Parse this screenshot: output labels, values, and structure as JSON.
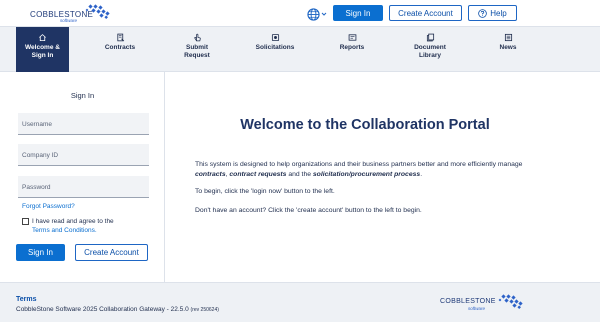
{
  "header": {
    "logo_text": "COBBLESTONE",
    "logo_sub": "software",
    "signin_label": "Sign In",
    "create_account_label": "Create Account",
    "help_label": "Help"
  },
  "nav": {
    "items": [
      {
        "label": "Welcome & Sign In",
        "icon": "home-icon"
      },
      {
        "label": "Contracts",
        "icon": "contract-icon"
      },
      {
        "label": "Submit Request",
        "icon": "hand-pointer-icon"
      },
      {
        "label": "Solicitations",
        "icon": "solicitation-icon"
      },
      {
        "label": "Reports",
        "icon": "reports-icon"
      },
      {
        "label": "Document Library",
        "icon": "document-library-icon"
      },
      {
        "label": "News",
        "icon": "news-icon"
      }
    ]
  },
  "signin": {
    "title": "Sign In",
    "username_placeholder": "Username",
    "company_placeholder": "Company ID",
    "password_placeholder": "Password",
    "forgot_label": "Forgot Password?",
    "agree_text": "I have read and agree to the",
    "terms_link": "Terms and Conditions.",
    "signin_button": "Sign In",
    "create_button": "Create Account"
  },
  "main": {
    "title": "Welcome to the Collaboration Portal",
    "p1_a": "This system is designed to help organizations and their business partners better and more efficiently manage ",
    "p1_b": "contracts",
    "p1_c": ", ",
    "p1_d": "contract requests",
    "p1_e": " and the ",
    "p1_f": "solicitation/procurement process",
    "p1_g": ".",
    "p2": "To begin, click the 'login now' button to the left.",
    "p3": "Don't have an account? Click the 'create account' button to the left to begin."
  },
  "footer": {
    "terms": "Terms",
    "copyright": "CobbleStone Software 2025  Collaboration Gateway - 22.5.0",
    "rev": "(rev 250624)",
    "logo_text": "COBBLESTONE",
    "logo_sub": "software"
  },
  "colors": {
    "primary": "#0b6fd0",
    "nav_active": "#1f3464",
    "title": "#1f3464"
  }
}
